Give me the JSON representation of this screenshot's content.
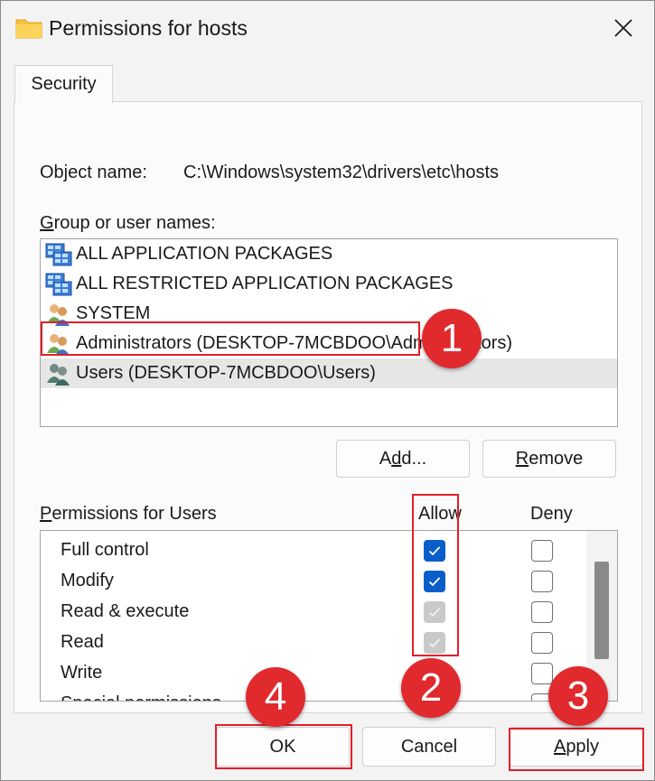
{
  "window": {
    "title": "Permissions for hosts",
    "tab": "Security"
  },
  "object": {
    "label": "Object name:",
    "value": "C:\\Windows\\system32\\drivers\\etc\\hosts"
  },
  "groups": {
    "label_accel": "G",
    "label_rest": "roup or user names:",
    "items": [
      {
        "label": "ALL APPLICATION PACKAGES",
        "icon": "package-group-icon"
      },
      {
        "label": "ALL RESTRICTED APPLICATION PACKAGES",
        "icon": "package-group-icon"
      },
      {
        "label": "SYSTEM",
        "icon": "users-icon"
      },
      {
        "label": "Administrators (DESKTOP-7MCBDOO\\Administrators)",
        "icon": "users-icon"
      },
      {
        "label": "Users (DESKTOP-7MCBDOO\\Users)",
        "icon": "users-icon",
        "selected": true
      }
    ]
  },
  "buttons": {
    "add_accel": "d",
    "add_pre": "A",
    "add_post": "d...",
    "remove_accel": "R",
    "remove_rest": "emove",
    "ok": "OK",
    "cancel": "Cancel",
    "apply_accel": "A",
    "apply_rest": "pply"
  },
  "permissions": {
    "label_accel": "P",
    "label_rest": "ermissions for Users",
    "allow_label": "Allow",
    "deny_label": "Deny",
    "rows": [
      {
        "name": "Full control",
        "allow": "checked",
        "deny": "unchecked"
      },
      {
        "name": "Modify",
        "allow": "checked",
        "deny": "unchecked"
      },
      {
        "name": "Read & execute",
        "allow": "inherited",
        "deny": "unchecked"
      },
      {
        "name": "Read",
        "allow": "inherited",
        "deny": "unchecked"
      },
      {
        "name": "Write",
        "allow": "checked",
        "deny": "unchecked"
      },
      {
        "name": "Special permissions",
        "allow": "unchecked",
        "deny": "unchecked"
      }
    ]
  },
  "annotations": {
    "step1": "1",
    "step2": "2",
    "step3": "3",
    "step4": "4"
  },
  "colors": {
    "accent": "#0a5ec9",
    "annotation_red": "#e02a2e"
  }
}
